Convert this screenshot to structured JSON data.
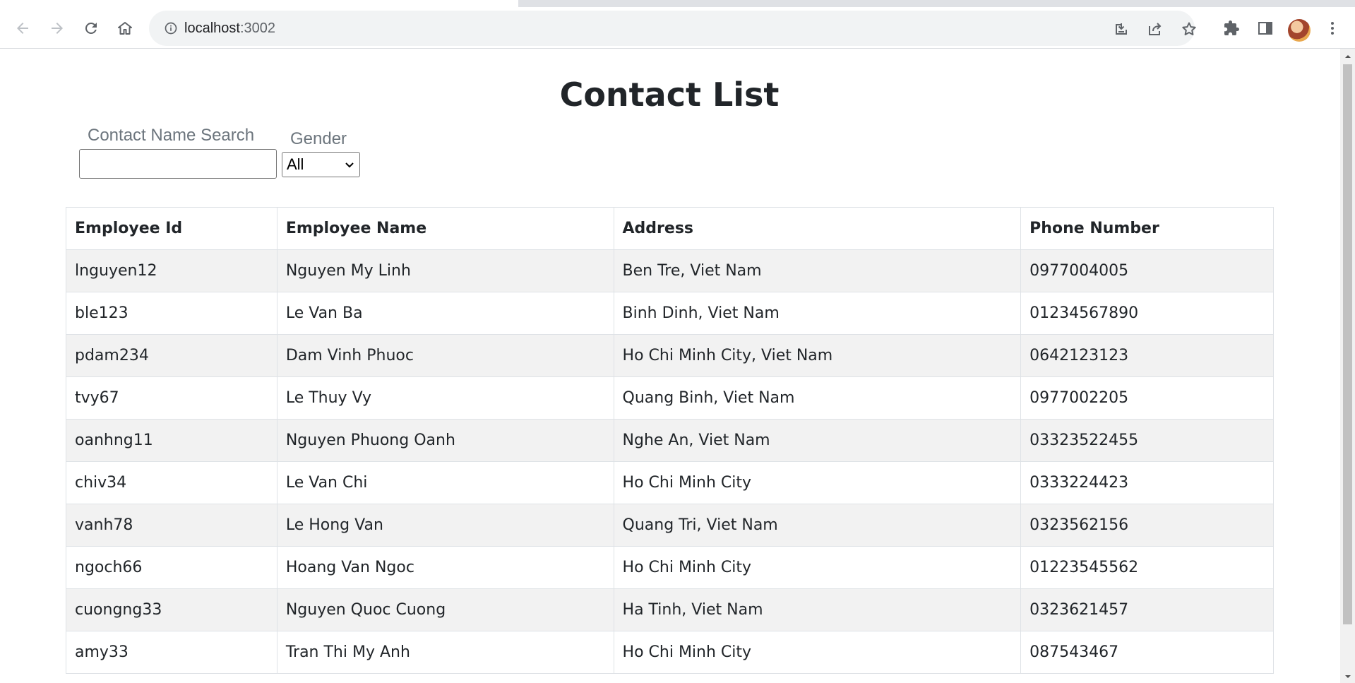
{
  "browser": {
    "url_host": "localhost",
    "url_port": ":3002"
  },
  "page": {
    "title": "Contact List",
    "search": {
      "label": "Contact Name Search",
      "value": "",
      "placeholder": ""
    },
    "gender": {
      "label": "Gender",
      "selected": "All"
    }
  },
  "table": {
    "headers": [
      "Employee Id",
      "Employee Name",
      "Address",
      "Phone Number"
    ],
    "rows": [
      [
        "lnguyen12",
        "Nguyen My Linh",
        "Ben Tre, Viet Nam",
        "0977004005"
      ],
      [
        "ble123",
        "Le Van Ba",
        "Binh Dinh, Viet Nam",
        "01234567890"
      ],
      [
        "pdam234",
        "Dam Vinh Phuoc",
        "Ho Chi Minh City, Viet Nam",
        "0642123123"
      ],
      [
        "tvy67",
        "Le Thuy Vy",
        "Quang Binh, Viet Nam",
        "0977002205"
      ],
      [
        "oanhng11",
        "Nguyen Phuong Oanh",
        "Nghe An, Viet Nam",
        "03323522455"
      ],
      [
        "chiv34",
        "Le Van Chi",
        "Ho Chi Minh City",
        "0333224423"
      ],
      [
        "vanh78",
        "Le Hong Van",
        "Quang Tri, Viet Nam",
        "0323562156"
      ],
      [
        "ngoch66",
        "Hoang Van Ngoc",
        "Ho Chi Minh City",
        "01223545562"
      ],
      [
        "cuongng33",
        "Nguyen Quoc Cuong",
        "Ha Tinh, Viet Nam",
        "0323621457"
      ],
      [
        "amy33",
        "Tran Thi My Anh",
        "Ho Chi Minh City",
        "087543467"
      ]
    ]
  },
  "icons": {
    "back": "arrow-left-icon",
    "forward": "arrow-right-icon",
    "reload": "reload-icon",
    "home": "home-icon",
    "site_info": "info-icon",
    "install": "install-icon",
    "share": "share-icon",
    "bookmark": "star-icon",
    "extensions": "puzzle-icon",
    "side_panel": "side-panel-icon",
    "menu": "kebab-menu-icon"
  }
}
